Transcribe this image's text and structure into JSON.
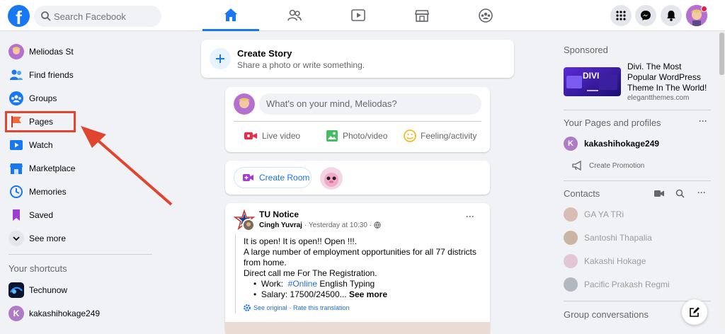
{
  "topbar": {
    "logo_letter": "f",
    "search_placeholder": "Search Facebook"
  },
  "sidebar": {
    "items": [
      {
        "label": "Meliodas St"
      },
      {
        "label": "Find friends"
      },
      {
        "label": "Groups"
      },
      {
        "label": "Pages"
      },
      {
        "label": "Watch"
      },
      {
        "label": "Marketplace"
      },
      {
        "label": "Memories"
      },
      {
        "label": "Saved"
      },
      {
        "label": "See more"
      }
    ],
    "shortcuts_title": "Your shortcuts",
    "shortcuts": [
      {
        "label": "Techunow"
      },
      {
        "label": "kakashihokage249",
        "initial": "K"
      }
    ]
  },
  "create_story": {
    "title": "Create Story",
    "subtitle": "Share a photo or write something."
  },
  "composer": {
    "placeholder": "What's on your mind, Meliodas?",
    "actions": [
      {
        "label": "Live video"
      },
      {
        "label": "Photo/video"
      },
      {
        "label": "Feeling/activity"
      }
    ]
  },
  "room": {
    "button": "Create Room"
  },
  "post": {
    "page": "TU Notice",
    "author": "Cingh Yuvraj",
    "time": "· Yesterday at 10:30 ·",
    "more": "···",
    "lines": [
      "It is open! It is open!! Open !!!.",
      "A large number of employment opportunities for all 77 districts",
      "from home.",
      "Direct call me  For The Registration."
    ],
    "bullet1_prefix": "Work:",
    "bullet1_link": "#Online",
    "bullet1_suffix": "English Typing",
    "bullet2": "Salary: 17500/24500...",
    "see_more": "See more",
    "see_original": "See original",
    "rate": "· Rate this translation"
  },
  "right": {
    "sponsored": "Sponsored",
    "ad": {
      "brand_text": "DIVI",
      "title": "Divi. The Most Popular WordPress Theme In The World!",
      "domain": "elegantthemes.com"
    },
    "pages_title": "Your Pages and profiles",
    "pages_more": "···",
    "page_name": "kakashihokage249",
    "page_initial": "K",
    "create_promotion": "Create Promotion",
    "contacts_title": "Contacts",
    "contacts_more": "···",
    "contacts": [
      {
        "name": "GA YA TRi"
      },
      {
        "name": "Santoshi Thapalia"
      },
      {
        "name": "Kakashi Hokage"
      },
      {
        "name": "Pacific Prakash Regmi"
      }
    ],
    "group_conv_title": "Group conversations"
  }
}
